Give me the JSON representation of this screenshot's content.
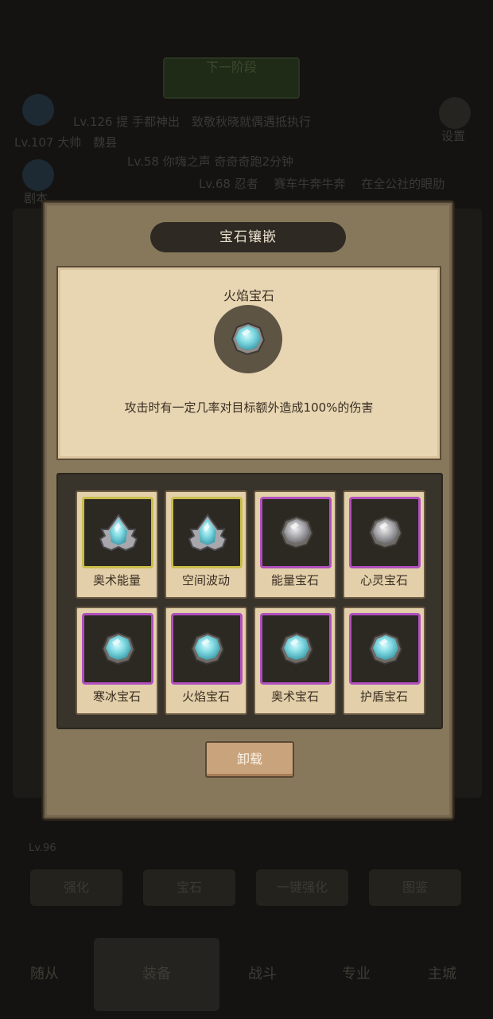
{
  "background": {
    "top_button": "下一阶段",
    "line1": "Lv.126 提 手都神出　致敬秋晓就偶遇抵执行",
    "line2": "Lv.107 大帅　魏县",
    "line3": "Lv.58 你嗨之声 奇奇奇跑2分钟",
    "line4": "Lv.68 忍者　 赛车牛奔牛奔　 在全公社的眼肋",
    "settings": "设置",
    "left_label": "剧本",
    "level": "Lv.96",
    "buttons": [
      "强化",
      "宝石",
      "一键强化",
      "图鉴"
    ],
    "tabs": [
      "随从",
      "装备",
      "战斗",
      "专业",
      "主城"
    ]
  },
  "modal": {
    "title": "宝石镶嵌",
    "detail": {
      "name": "火焰宝石",
      "icon": "blue-gem-icon",
      "description": "攻击时有一定几率对目标额外造成100%的伤害"
    },
    "slots": [
      {
        "label": "奥术能量",
        "frame": "gold",
        "icon": "spiked-blue-gem-icon"
      },
      {
        "label": "空间波动",
        "frame": "gold",
        "icon": "spiked-blue-gem-icon"
      },
      {
        "label": "能量宝石",
        "frame": "purple",
        "icon": "gray-gem-icon"
      },
      {
        "label": "心灵宝石",
        "frame": "purple",
        "icon": "gray-gem-icon"
      },
      {
        "label": "寒冰宝石",
        "frame": "purple",
        "icon": "blue-gem-icon"
      },
      {
        "label": "火焰宝石",
        "frame": "purple",
        "icon": "blue-gem-icon"
      },
      {
        "label": "奥术宝石",
        "frame": "purple",
        "icon": "blue-gem-icon"
      },
      {
        "label": "护盾宝石",
        "frame": "purple",
        "icon": "blue-gem-icon"
      }
    ],
    "unmount_label": "卸载"
  },
  "colors": {
    "gold_frame": "#c9bd4a",
    "purple_frame": "#b04fbd",
    "parchment": "#e8d6b3",
    "gem_blue": "#7fd8e0",
    "gem_gray": "#a9a9ad"
  }
}
